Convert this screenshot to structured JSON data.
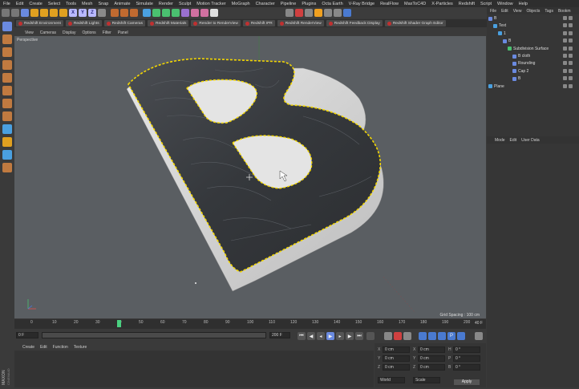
{
  "menubar": [
    "File",
    "Edit",
    "Create",
    "Select",
    "Tools",
    "Mesh",
    "Snap",
    "Animate",
    "Simulate",
    "Render",
    "Sculpt",
    "Motion Tracker",
    "MoGraph",
    "Character",
    "Pipeline",
    "Plugins",
    "Octa Earth",
    "V-Ray Bridge",
    "RealFlow",
    "MaxToC4D",
    "X-Particles",
    "Redshift",
    "Script",
    "Window",
    "Help"
  ],
  "toolbar": {
    "axis_x": "X",
    "axis_y": "Y",
    "axis_z": "Z"
  },
  "redshift_tabs": [
    "Redshift Environment",
    "Redshift Lights",
    "Redshift Cameras",
    "Redshift Materials",
    "Render to RenderView",
    "Redshift IPR",
    "Redshift RenderView",
    "Redshift Feedback Display",
    "Redshift Shader Graph Editor"
  ],
  "viewport": {
    "menu": [
      "View",
      "Cameras",
      "Display",
      "Options",
      "Filter",
      "Panel"
    ],
    "label": "Perspective",
    "grid_spacing": "Grid Spacing : 100 cm"
  },
  "timeline": {
    "ticks": [
      "0",
      "10",
      "20",
      "30",
      "40",
      "50",
      "60",
      "70",
      "80",
      "90",
      "100",
      "110",
      "120",
      "130",
      "140",
      "150",
      "160",
      "170",
      "180",
      "190",
      "200"
    ],
    "current_frame": "40 F",
    "current_frame_position": 0.2
  },
  "playback": {
    "start_field": "0 F",
    "slider_field": "200 F",
    "end_field": "200 F"
  },
  "material_menu": [
    "Create",
    "Edit",
    "Function",
    "Texture"
  ],
  "coords": {
    "rows": [
      {
        "a": "X",
        "v1": "0 cm",
        "b": "X",
        "v2": "0 cm",
        "c": "H",
        "v3": "0 °"
      },
      {
        "a": "Y",
        "v1": "0 cm",
        "b": "Y",
        "v2": "0 cm",
        "c": "P",
        "v3": "0 °"
      },
      {
        "a": "Z",
        "v1": "0 cm",
        "b": "Z",
        "v2": "0 cm",
        "c": "B",
        "v3": "0 °"
      }
    ],
    "mode1": "World",
    "mode2": "Scale",
    "apply": "Apply"
  },
  "object_manager": {
    "menu": [
      "File",
      "Edit",
      "View",
      "Objects",
      "Tags",
      "Bookm"
    ],
    "objects": [
      "B",
      "Text",
      "1",
      "B",
      "Subdivision Surface",
      "B cloth",
      "Rounding",
      "Cap 2",
      "B",
      "Plane"
    ]
  },
  "attribute_manager": {
    "menu": [
      "Mode",
      "Edit",
      "User Data"
    ]
  },
  "brand": "MAXON CINEMA 4D",
  "colors": {
    "viewport_bg": "#5a5e62",
    "accent_yellow": "#f5d800",
    "cloth": "#3e4146"
  }
}
